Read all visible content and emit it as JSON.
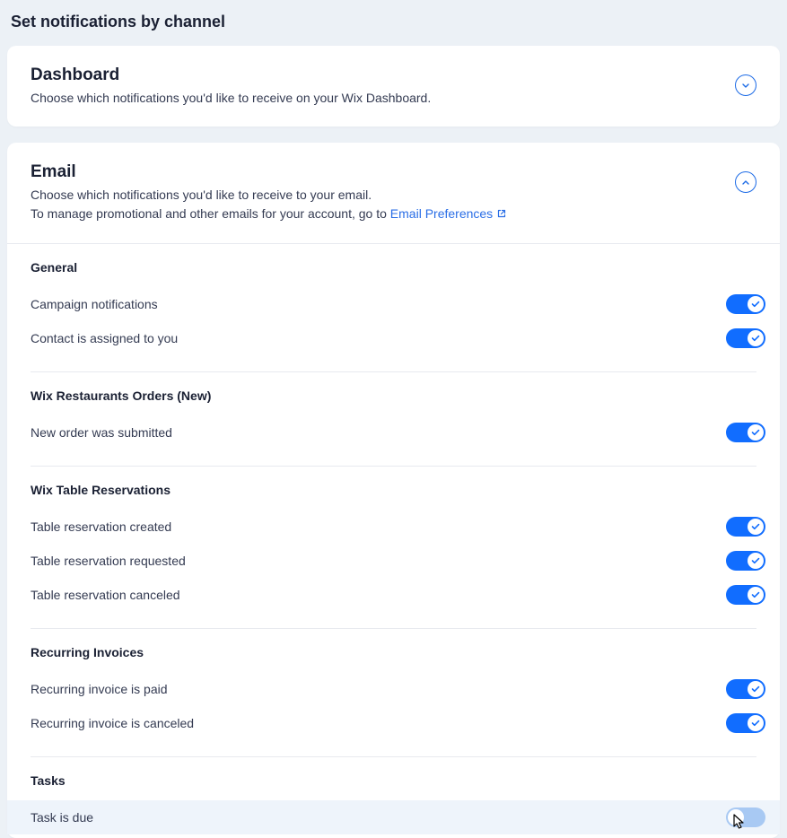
{
  "page_title": "Set notifications by channel",
  "dashboard": {
    "title": "Dashboard",
    "desc": "Choose which notifications you'd like to receive on your Wix Dashboard."
  },
  "email": {
    "title": "Email",
    "desc_line1": "Choose which notifications you'd like to receive to your email.",
    "desc_line2_prefix": "To manage promotional and other emails for your account, go to ",
    "link_label": "Email Preferences"
  },
  "sections": [
    {
      "title": "General",
      "items": [
        {
          "label": "Campaign notifications",
          "on": true
        },
        {
          "label": "Contact is assigned to you",
          "on": true
        }
      ]
    },
    {
      "title": "Wix Restaurants Orders (New)",
      "items": [
        {
          "label": "New order was submitted",
          "on": true
        }
      ]
    },
    {
      "title": "Wix Table Reservations",
      "items": [
        {
          "label": "Table reservation created",
          "on": true
        },
        {
          "label": "Table reservation requested",
          "on": true
        },
        {
          "label": "Table reservation canceled",
          "on": true
        }
      ]
    },
    {
      "title": "Recurring Invoices",
      "items": [
        {
          "label": "Recurring invoice is paid",
          "on": true
        },
        {
          "label": "Recurring invoice is canceled",
          "on": true
        }
      ]
    },
    {
      "title": "Tasks",
      "items": [
        {
          "label": "Task is due",
          "on": false,
          "hover": true,
          "cursor": true
        }
      ]
    }
  ]
}
